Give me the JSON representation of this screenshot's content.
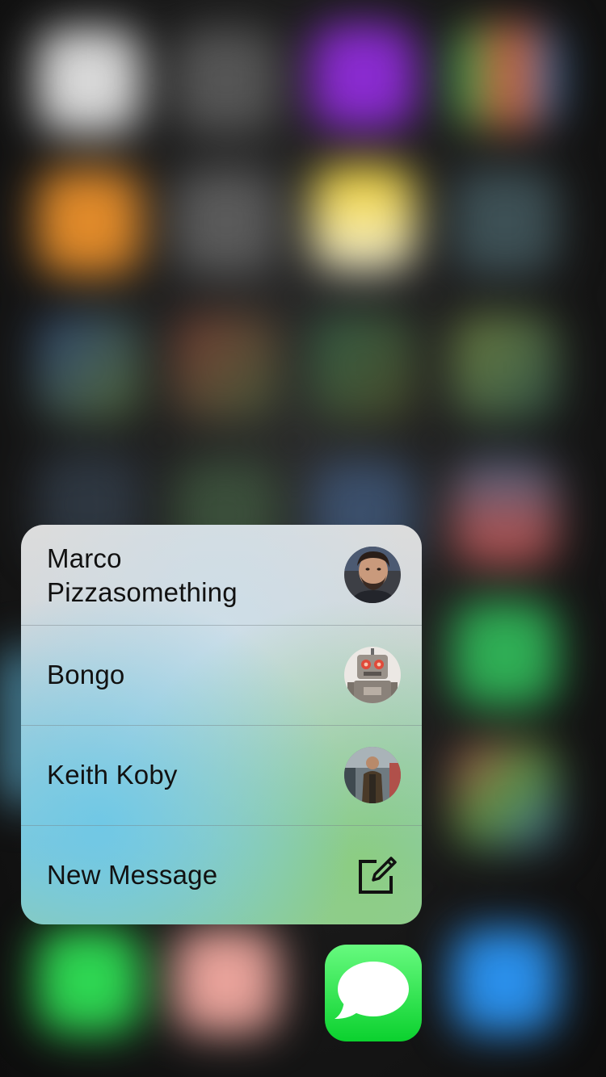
{
  "menu": {
    "items": [
      {
        "label": "Marco\nPizzasomething",
        "icon": "contact-avatar-marco"
      },
      {
        "label": "Bongo",
        "icon": "contact-avatar-bongo-robot"
      },
      {
        "label": "Keith Koby",
        "icon": "contact-avatar-keith"
      },
      {
        "label": "New Message",
        "icon": "compose-icon"
      }
    ]
  },
  "app_icon": {
    "name": "messages-app-icon",
    "colors": {
      "top": "#67fa7f",
      "bottom": "#0bd12e",
      "bubble": "#ffffff"
    }
  },
  "colors": {
    "menu_text": "#111111",
    "divider": "#7e8386"
  }
}
